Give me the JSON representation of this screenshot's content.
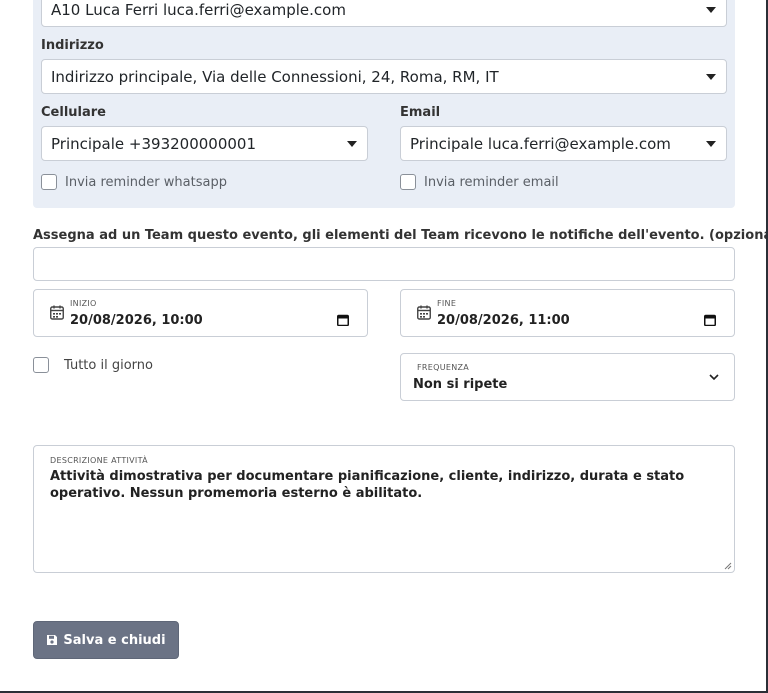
{
  "cliente": {
    "value": "A10 Luca Ferri luca.ferri@example.com"
  },
  "indirizzo": {
    "label": "Indirizzo",
    "value": "Indirizzo principale, Via delle Connessioni, 24, Roma, RM, IT"
  },
  "cellulare": {
    "label": "Cellulare",
    "value": "Principale +393200000001",
    "reminder": "Invia reminder whatsapp"
  },
  "email": {
    "label": "Email",
    "value": "Principale luca.ferri@example.com",
    "reminder": "Invia reminder email"
  },
  "team": {
    "label": "Assegna ad un Team questo evento, gli elementi del Team ricevono le notifiche dell'evento. (opzionale)",
    "value": ""
  },
  "inizio": {
    "label": "INIZIO",
    "value": "20/08/2026, 10:00"
  },
  "fine": {
    "label": "FINE",
    "value": "20/08/2026, 11:00"
  },
  "tutto_il_giorno": {
    "label": "Tutto il giorno"
  },
  "frequenza": {
    "label": "FREQUENZA",
    "value": "Non si ripete"
  },
  "descrizione": {
    "label": "DESCRIZIONE ATTIVITÀ",
    "value": "Attività dimostrativa per documentare pianificazione, cliente, indirizzo, durata e stato operativo. Nessun promemoria esterno è abilitato."
  },
  "save_button": {
    "label": "Salva e chiudi",
    "icon": "floppy-disk-icon"
  }
}
